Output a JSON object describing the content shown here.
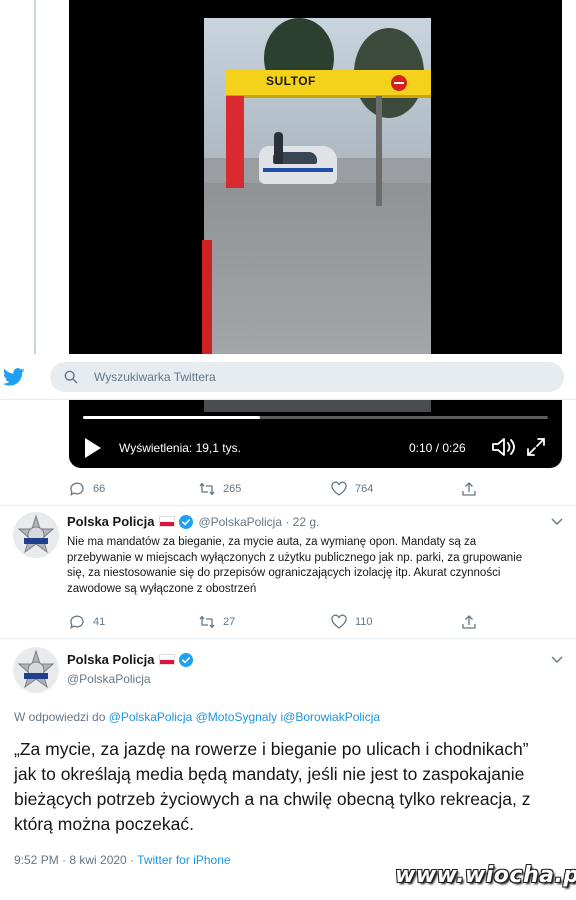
{
  "header": {
    "search_placeholder": "Wyszukiwarka Twittera"
  },
  "video": {
    "overlay_sign": "SULTOF",
    "views_label": "Wyświetlenia: 19,1 tys.",
    "time": "0:10 / 0:26",
    "progress": 0.38
  },
  "quoted_tweet_actions": {
    "replies": "66",
    "retweets": "265",
    "likes": "764"
  },
  "reply_tweet": {
    "author_name": "Polska Policja",
    "handle_time": "@PolskaPolicja · 22 g.",
    "text": "Nie ma mandatów za bieganie, za mycie auta, za wymianę opon. Mandaty są za przebywanie w miejscach wyłączonych z użytku publicznego jak np. parki, za grupowanie się, za niestosowanie się do przepisów ograniczających izolację itp. Akurat czynności zawodowe są wyłączone z obostrzeń",
    "replies": "41",
    "retweets": "27",
    "likes": "110"
  },
  "main_tweet": {
    "author_name": "Polska Policja",
    "handle": "@PolskaPolicja",
    "reply_prefix": "W odpowiedzi do ",
    "reply_mentions": "@PolskaPolicja @MotoSygnaly i@BorowiakPolicja",
    "text": "„Za mycie, za jazdę na rowerze i bieganie po ulicach i chodnikach” jak to określają media będą mandaty, jeśli nie jest to zaspokajanie bieżących potrzeb życiowych a na chwilę obecną tylko rekreacja, z którą można poczekać.",
    "timestamp": "9:52 PM · 8 kwi 2020 · ",
    "source": "Twitter for iPhone"
  },
  "watermark": "www.wiocha.pl",
  "colors": {
    "twitter_blue": "#1da1f2",
    "link_blue": "#1b95e0",
    "gray_text": "#657786"
  }
}
